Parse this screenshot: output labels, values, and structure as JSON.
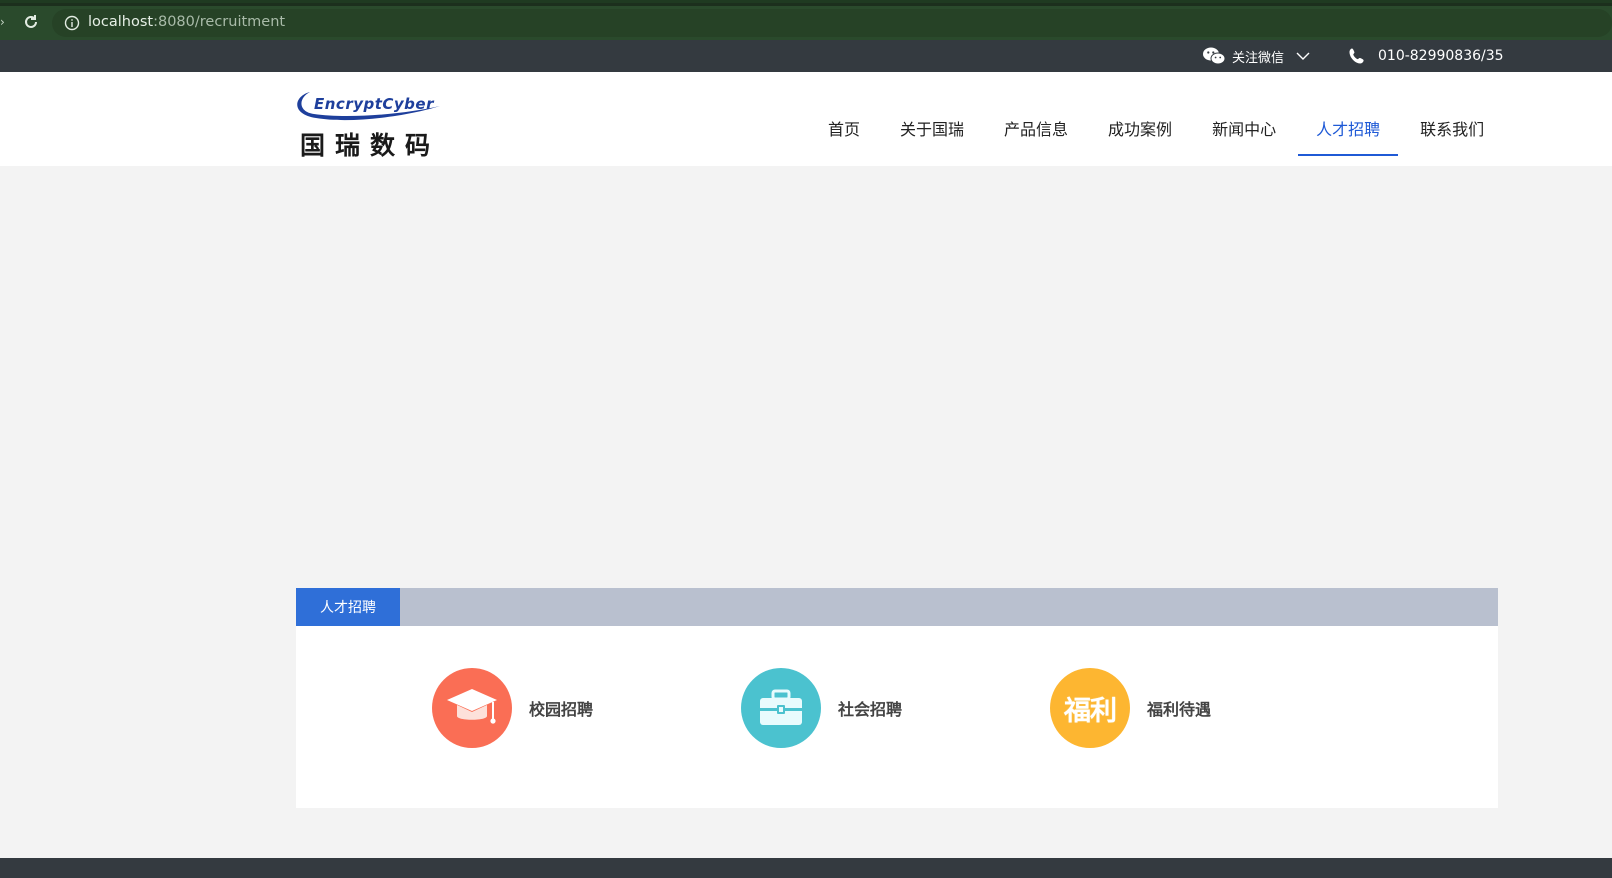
{
  "browser": {
    "url_host": "localhost",
    "url_path": ":8080/recruitment"
  },
  "topbar": {
    "wechat_label": "关注微信",
    "phone": "010-82990836/35"
  },
  "logo": {
    "brand_en": "EncryptCyber",
    "brand_cn": "国瑞数码"
  },
  "nav": {
    "items": [
      {
        "label": "首页"
      },
      {
        "label": "关于国瑞"
      },
      {
        "label": "产品信息"
      },
      {
        "label": "成功案例"
      },
      {
        "label": "新闻中心"
      },
      {
        "label": "人才招聘"
      },
      {
        "label": "联系我们"
      }
    ],
    "active_index": 5,
    "active_color": "#1f5ad6"
  },
  "section": {
    "title": "人才招聘",
    "title_bg": "#2f6fd8",
    "header_bg": "#b9c0cf",
    "cards": [
      {
        "label": "校园招聘",
        "icon": "graduation-cap-icon",
        "color": "#fa6e55"
      },
      {
        "label": "社会招聘",
        "icon": "briefcase-icon",
        "color": "#4bc2cf"
      },
      {
        "label": "福利待遇",
        "icon": "benefits-icon",
        "icon_text": "福利",
        "color": "#fdb631"
      }
    ]
  }
}
